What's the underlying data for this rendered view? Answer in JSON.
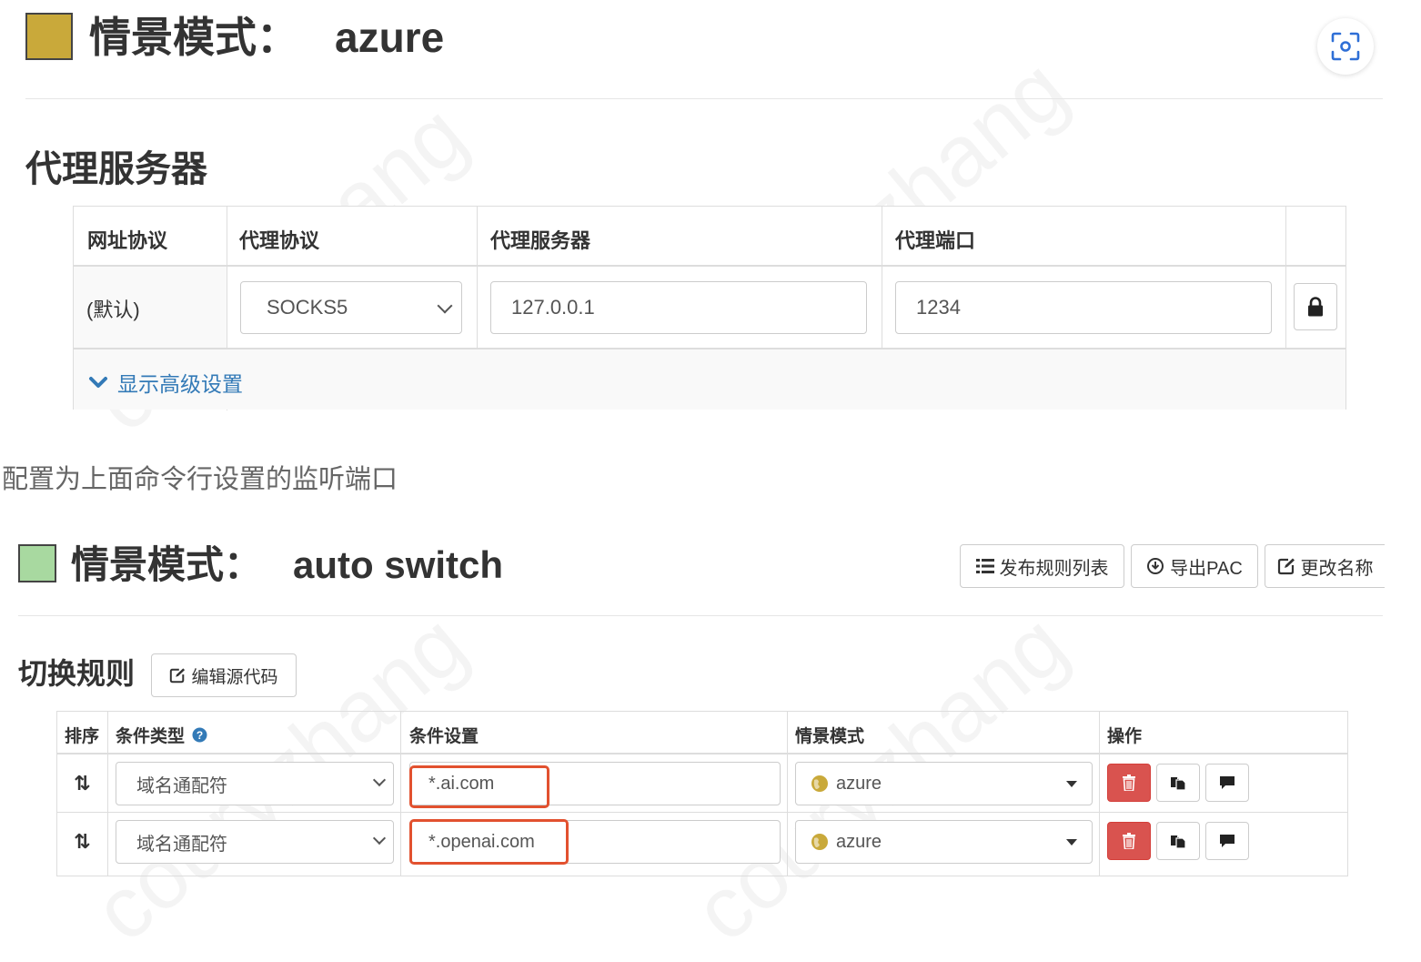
{
  "profile_azure": {
    "swatch_color": "#c9a93a",
    "title_prefix": "情景模式：",
    "title_name": "azure",
    "proxy_section_title": "代理服务器",
    "table_headers": [
      "网址协议",
      "代理协议",
      "代理服务器",
      "代理端口"
    ],
    "row_scheme": "(默认)",
    "protocol_value": "SOCKS5",
    "server_value": "127.0.0.1",
    "port_value": "1234",
    "lock_icon": "lock-icon",
    "advanced_toggle": "显示高级设置"
  },
  "caption": "配置为上面命令行设置的监听端口",
  "profile_auto": {
    "swatch_color": "#a8d9a0",
    "title_prefix": "情景模式：",
    "title_name": "auto switch",
    "toolbar": {
      "publish_label": "发布规则列表",
      "export_label": "导出PAC",
      "rename_label": "更改名称"
    },
    "rules_title": "切换规则",
    "edit_source_label": "编辑源代码",
    "headers": {
      "sort": "排序",
      "condition_type": "条件类型",
      "condition_setting": "条件设置",
      "profile": "情景模式",
      "actions": "操作"
    },
    "rules": [
      {
        "type": "域名通配符",
        "pattern": "*.ai.com",
        "profile": "azure"
      },
      {
        "type": "域名通配符",
        "pattern": "*.openai.com",
        "profile": "azure"
      }
    ]
  },
  "colors": {
    "link": "#337ab7",
    "danger": "#d9534f",
    "highlight_outline": "#e2512f"
  }
}
